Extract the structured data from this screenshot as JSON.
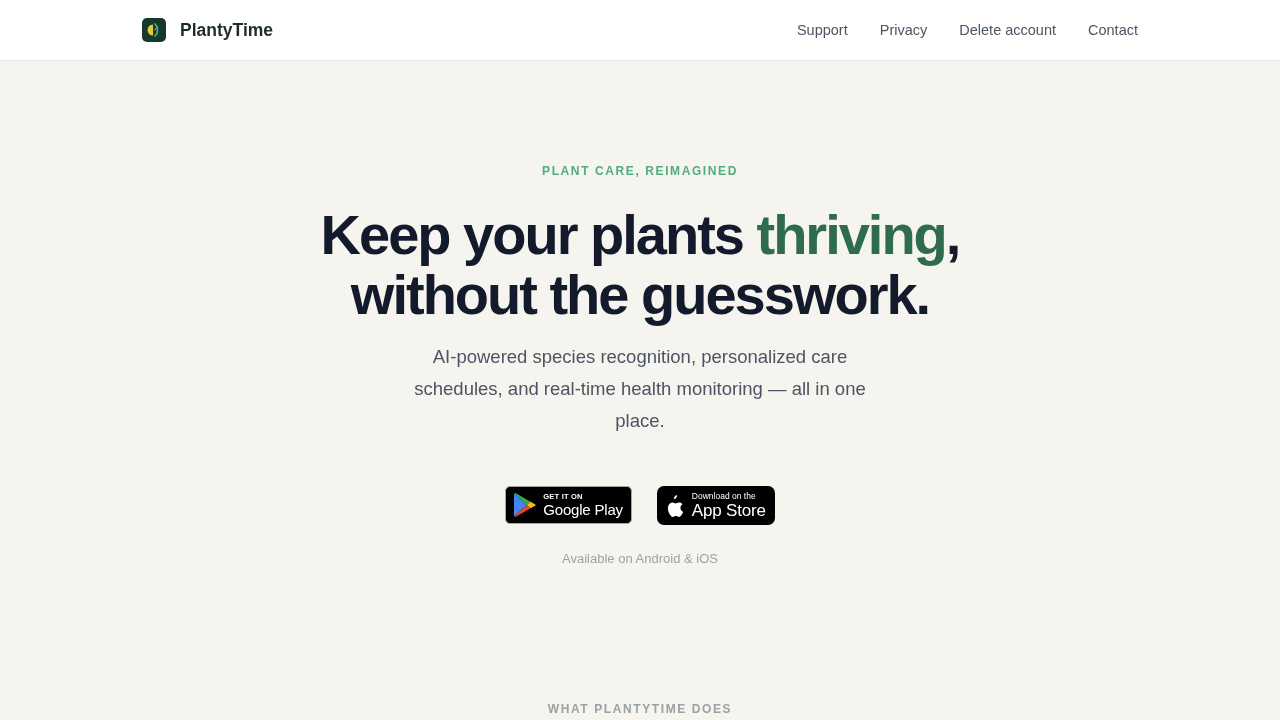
{
  "header": {
    "brand": "PlantyTime",
    "nav": [
      {
        "label": "Support"
      },
      {
        "label": "Privacy"
      },
      {
        "label": "Delete account"
      },
      {
        "label": "Contact"
      }
    ]
  },
  "hero": {
    "eyebrow": "PLANT CARE, REIMAGINED",
    "headline": {
      "before": "Keep your plants",
      "accent": "thriving",
      "after": ", without the guesswork."
    },
    "subtitle": "AI-powered species recognition, personalized care schedules, and real-time health monitoring — all in one place.",
    "store_badges": [
      {
        "kind": "google_play",
        "small": "GET IT ON",
        "large": "Google Play"
      },
      {
        "kind": "app_store",
        "small": "Download on the",
        "large": "App Store"
      }
    ],
    "availability": "Available on Android & iOS"
  },
  "features": {
    "eyebrow": "WHAT PLANTYTIME DOES"
  }
}
